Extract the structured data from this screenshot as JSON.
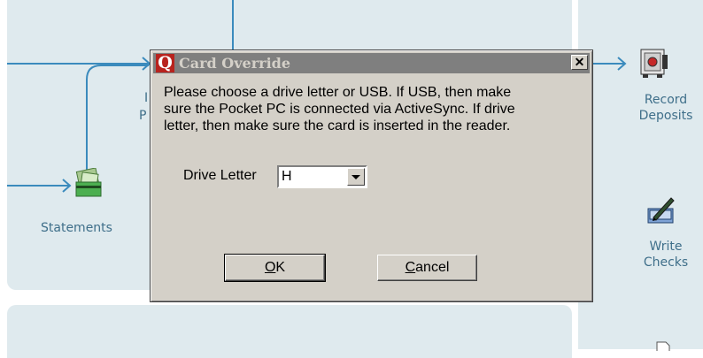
{
  "workflow": {
    "left_labels": [
      {
        "key": "statements",
        "text": "Statements"
      }
    ],
    "partial_labels": [
      "I",
      "P"
    ],
    "right_items": [
      {
        "key": "record_deposits",
        "line1": "Record",
        "line2": "Deposits",
        "icon": "safe-icon"
      },
      {
        "key": "write_checks",
        "line1": "Write",
        "line2": "Checks",
        "icon": "checkbook-pen-icon"
      }
    ],
    "colors": {
      "panel": "#dfeaee",
      "line": "#3b8bbd",
      "label": "#3f6f8a"
    }
  },
  "dialog": {
    "app_icon_letter": "Q",
    "title": "Card Override",
    "close_label": "✕",
    "message_lines": [
      "Please choose a drive letter or USB.  If USB, then make",
      "sure the Pocket PC is connected via ActiveSync.  If drive",
      "letter, then make sure the card is inserted in the reader."
    ],
    "drive_label": "Drive Letter",
    "drive_value": "H",
    "ok": {
      "mnemonic": "O",
      "rest": "K"
    },
    "cancel": {
      "mnemonic": "C",
      "rest": "ancel"
    },
    "colors": {
      "face": "#d4d0c8",
      "titlebar": "#7f7f7f",
      "app_icon": "#b8231e"
    }
  }
}
